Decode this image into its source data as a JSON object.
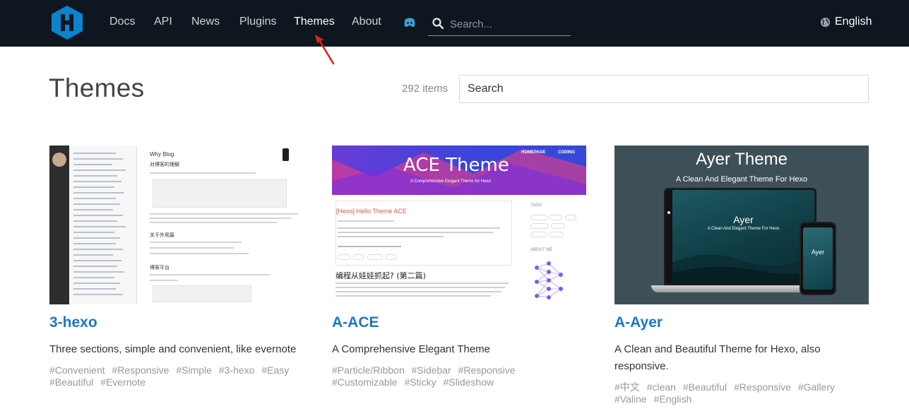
{
  "nav": {
    "items": [
      {
        "label": "Docs",
        "active": false
      },
      {
        "label": "API",
        "active": false
      },
      {
        "label": "News",
        "active": false
      },
      {
        "label": "Plugins",
        "active": false
      },
      {
        "label": "Themes",
        "active": true
      },
      {
        "label": "About",
        "active": false
      }
    ],
    "search_placeholder": "Search...",
    "language": "English"
  },
  "page": {
    "title": "Themes",
    "item_count": "292 items",
    "search_placeholder": "Search"
  },
  "themes": [
    {
      "name": "3-hexo",
      "description": "Three sections, simple and convenient, like evernote",
      "tags": [
        "#Convenient",
        "#Responsive",
        "#Simple",
        "#3-hexo",
        "#Easy",
        "#Beautiful",
        "#Evernote"
      ],
      "preview": {
        "heading": "Why Blog",
        "subheading": "对博客的理解",
        "section": "关于外观篇",
        "section2": "博客平台"
      }
    },
    {
      "name": "A-ACE",
      "description": "A Comprehensive Elegant Theme",
      "tags": [
        "#Particle/Ribbon",
        "#Sidebar",
        "#Responsive",
        "#Customizable",
        "#Sticky",
        "#Slideshow"
      ],
      "preview": {
        "banner_title": "ACE Theme",
        "banner_subtitle": "A Comprehensive Elegant Theme for Hexo",
        "nav_home": "HOMEPAGE",
        "nav_coding": "CODING",
        "post_title": "[Hexo] Hello Theme ACE",
        "post2_title": "编程从娃娃抓起? (第二篇)",
        "tags_label": "TAGS",
        "about_label": "ABOUT ME"
      }
    },
    {
      "name": "A-Ayer",
      "description": "A Clean and Beautiful Theme for Hexo, also responsive.",
      "tags": [
        "#中文",
        "#clean",
        "#Beautiful",
        "#Responsive",
        "#Gallery",
        "#Valine",
        "#English"
      ],
      "preview": {
        "title": "Ayer Theme",
        "subtitle": "A Clean And Elegant Theme For Hexo",
        "screen_title": "Ayer",
        "screen_subtitle": "A Clean And Elegant Theme For Hexo"
      }
    }
  ],
  "colors": {
    "header_bg": "#0e171f",
    "link_blue": "#1f76c1",
    "logo_blue": "#0e83cd",
    "annotation_red": "#e02020"
  },
  "icons": [
    "hexo-logo-icon",
    "discord-icon",
    "search-icon",
    "globe-icon",
    "red-arrow-annotation"
  ]
}
